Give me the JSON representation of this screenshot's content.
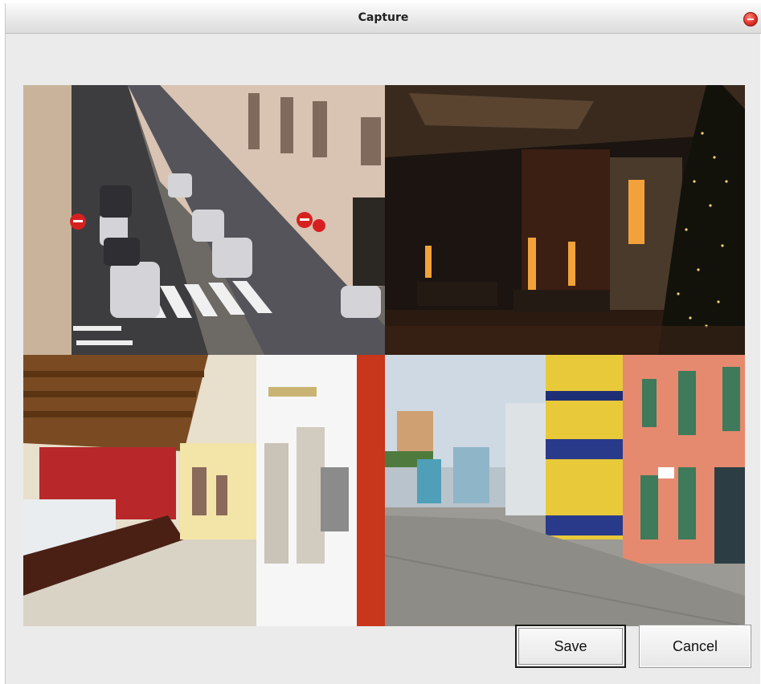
{
  "window": {
    "title": "Capture"
  },
  "cameras": [
    {
      "scene": "street-with-parked-cars"
    },
    {
      "scene": "hotel-lobby-night"
    },
    {
      "scene": "reception-hallway"
    },
    {
      "scene": "colonial-street"
    }
  ],
  "buttons": {
    "save_label": "Save",
    "cancel_label": "Cancel"
  },
  "colors": {
    "window_bg": "#ebebeb",
    "close_button": "#e0322a",
    "default_button_border": "#1a1a1a"
  }
}
